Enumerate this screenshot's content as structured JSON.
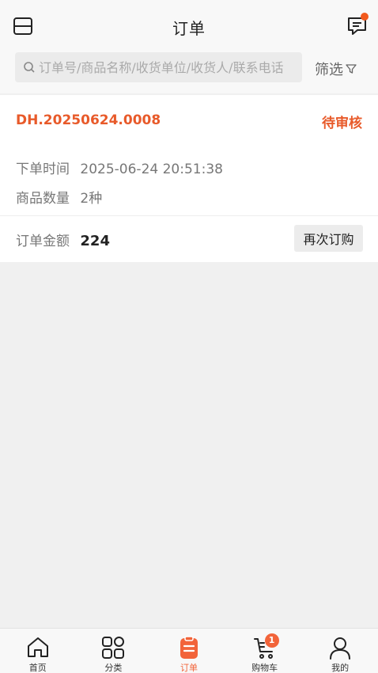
{
  "header": {
    "title": "订单",
    "search_placeholder": "订单号/商品名称/收货单位/收货人/联系电话",
    "filter_label": "筛选"
  },
  "order": {
    "number": "DH.20250624.0008",
    "status": "待审核",
    "time_label": "下单时间",
    "time_value": "2025-06-24 20:51:38",
    "qty_label": "商品数量",
    "qty_value": "2种",
    "amount_label": "订单金额",
    "amount_value": "224",
    "reorder_label": "再次订购"
  },
  "tabbar": {
    "items": [
      {
        "label": "首页",
        "icon": "home-icon"
      },
      {
        "label": "分类",
        "icon": "category-icon"
      },
      {
        "label": "订单",
        "icon": "order-icon",
        "active": true
      },
      {
        "label": "购物车",
        "icon": "cart-icon",
        "badge": "1"
      },
      {
        "label": "我的",
        "icon": "user-icon"
      }
    ]
  },
  "colors": {
    "accent": "#e85a2a",
    "tab_active": "#f2643a"
  }
}
